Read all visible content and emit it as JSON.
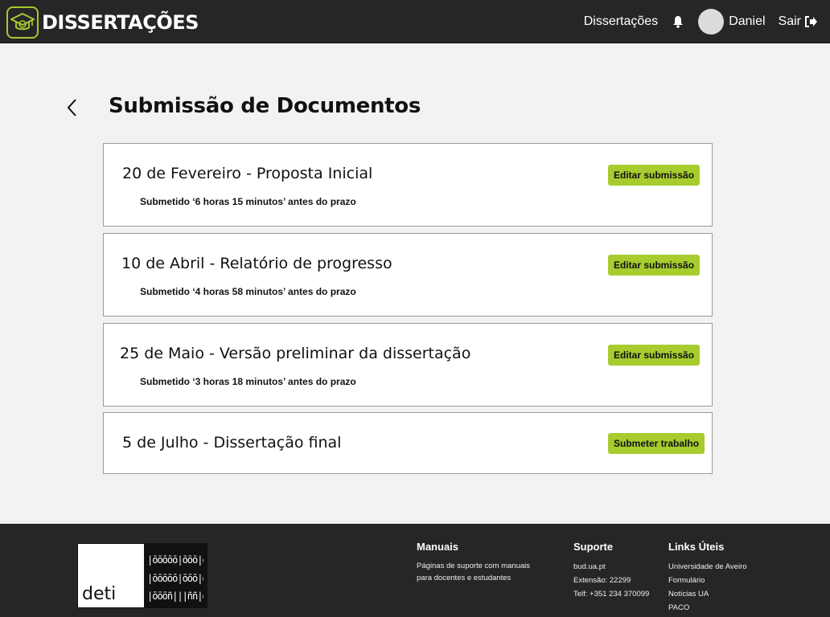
{
  "header": {
    "brand": "DISSERTAÇÕES",
    "nav_dissertacoes": "Dissertações",
    "user_name": "Daniel",
    "logout_label": "Sair",
    "accent": "#a6c832"
  },
  "page": {
    "title": "Submissão de Documentos"
  },
  "submissions": [
    {
      "title": "20 de Fevereiro - Proposta Inicial",
      "status": "Submetido ‘6 horas 15 minutos’ antes do prazo",
      "button": "Editar submissão"
    },
    {
      "title": "10 de Abril - Relatório de progresso",
      "status": "Submetido ‘4 horas 58 minutos’ antes do prazo",
      "button": "Editar submissão"
    },
    {
      "title": "25 de Maio - Versão preliminar da dissertação",
      "status": "Submetido ‘3 horas 18 minutos’ antes do prazo",
      "button": "Editar submissão"
    },
    {
      "title": "5 de Julho - Dissertação final",
      "button": "Submeter trabalho"
    }
  ],
  "footer": {
    "logo_text": "deti",
    "manuais": {
      "heading": "Manuais",
      "text_line1": "Páginas de suporte com manuais",
      "text_line2": "para docentes e estudantes"
    },
    "suporte": {
      "heading": "Suporte",
      "items": [
        "bud.ua.pt",
        "Extensão: 22299",
        "Telf: +351 234 370099"
      ]
    },
    "links": {
      "heading": "Links Úteis",
      "items": [
        "Universidade de Aveiro",
        "Formulário",
        "Notícias UA",
        "PACO"
      ]
    }
  }
}
